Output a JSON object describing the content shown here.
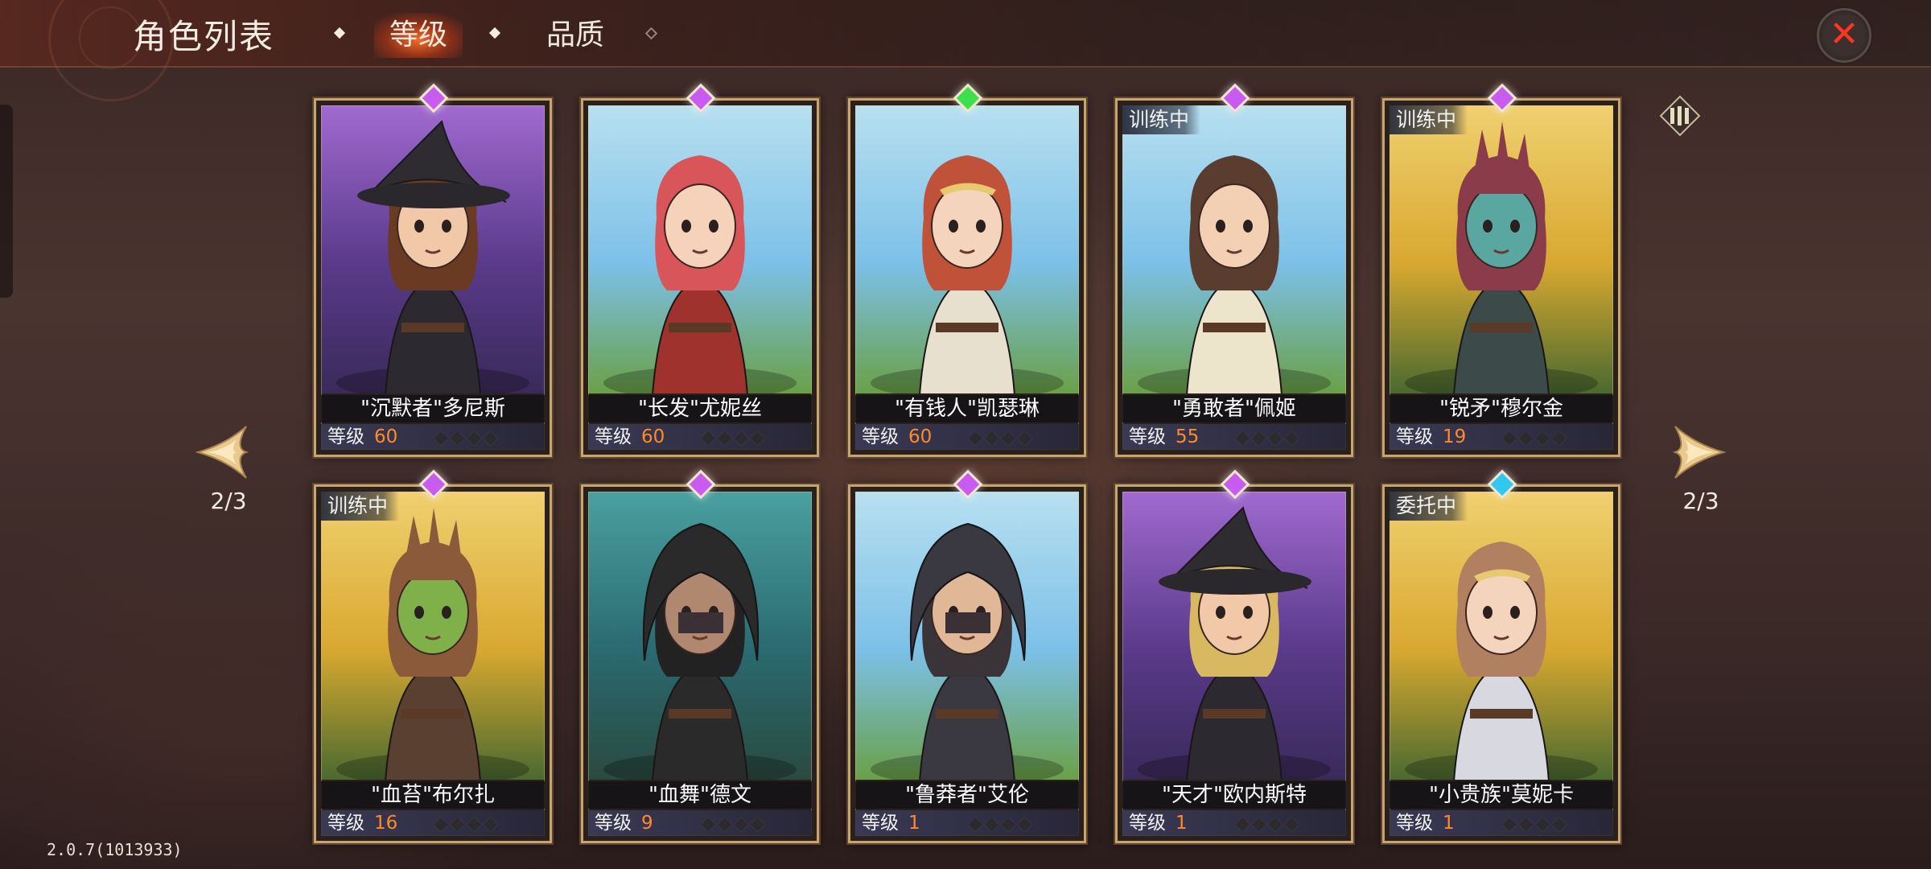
{
  "header": {
    "title": "角色列表",
    "tabs": [
      {
        "label": "等级",
        "active": true
      },
      {
        "label": "品质",
        "active": false
      }
    ]
  },
  "nav": {
    "left_page": "2/3",
    "right_page": "2/3"
  },
  "level_label": "等级",
  "version": "2.0.7(1013933)",
  "colors": {
    "accent_level": "#ff8a2a",
    "close_icon": "#ff3520",
    "gem_purple": "#c85cf0",
    "gem_green": "#3ce04a",
    "gem_cyan": "#30c8f0"
  },
  "heroes": [
    {
      "name": "\"沉默者\"多尼斯",
      "level": "60",
      "status": "",
      "gem": "purple",
      "bg": "purple",
      "hat": "wizard",
      "skin": "#f2c9a8",
      "hair": "#6b3a22",
      "outfit": "#2c2a30"
    },
    {
      "name": "\"长发\"尤妮丝",
      "level": "60",
      "status": "",
      "gem": "purple",
      "bg": "sky",
      "hat": "none",
      "skin": "#f6d2bb",
      "hair": "#d8555a",
      "outfit": "#a0322e"
    },
    {
      "name": "\"有钱人\"凯瑟琳",
      "level": "60",
      "status": "",
      "gem": "green",
      "bg": "sky",
      "hat": "tiara",
      "skin": "#f5d4bd",
      "hair": "#c0523a",
      "outfit": "#e8e0cf"
    },
    {
      "name": "\"勇敢者\"佩姬",
      "level": "55",
      "status": "训练中",
      "gem": "purple",
      "bg": "sky",
      "hat": "none",
      "skin": "#f3d0b4",
      "hair": "#5a3d2e",
      "outfit": "#ede4cc"
    },
    {
      "name": "\"锐矛\"穆尔金",
      "level": "19",
      "status": "训练中",
      "gem": "purple",
      "bg": "forest",
      "hat": "mohawk",
      "skin": "#5aa6a0",
      "hair": "#8a3c4a",
      "outfit": "#3c4a4a"
    },
    {
      "name": "\"血苔\"布尔扎",
      "level": "16",
      "status": "训练中",
      "gem": "purple",
      "bg": "forest",
      "hat": "mohawk",
      "skin": "#7fb04a",
      "hair": "#8a5a3a",
      "outfit": "#5a4030"
    },
    {
      "name": "\"血舞\"德文",
      "level": "9",
      "status": "",
      "gem": "purple",
      "bg": "teal",
      "hat": "hood",
      "skin": "#b08870",
      "hair": "#222222",
      "outfit": "#2a2a2a"
    },
    {
      "name": "\"鲁莽者\"艾伦",
      "level": "1",
      "status": "",
      "gem": "purple",
      "bg": "sky",
      "hat": "hood",
      "skin": "#e0b898",
      "hair": "#3a3438",
      "outfit": "#3a3840"
    },
    {
      "name": "\"天才\"欧内斯特",
      "level": "1",
      "status": "",
      "gem": "purple",
      "bg": "purple",
      "hat": "wizard",
      "skin": "#f2c9a8",
      "hair": "#d8b860",
      "outfit": "#2c2a30"
    },
    {
      "name": "\"小贵族\"莫妮卡",
      "level": "1",
      "status": "委托中",
      "gem": "cyan",
      "bg": "forest",
      "hat": "tiara",
      "skin": "#f5d4bd",
      "hair": "#b08060",
      "outfit": "#d8d8e0"
    }
  ]
}
